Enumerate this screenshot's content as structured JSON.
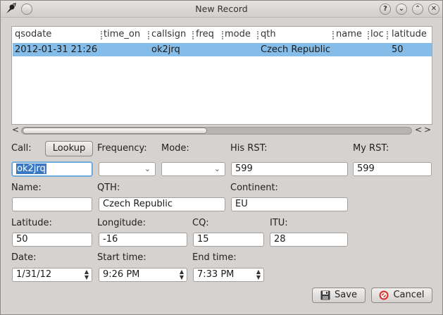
{
  "window": {
    "title": "New Record",
    "titlebar_buttons": {
      "help": "?",
      "minimize": "⌄",
      "maximize": "⌃",
      "close": "✕"
    }
  },
  "table": {
    "columns": [
      "qsodate",
      "time_on",
      "callsign",
      "freq",
      "mode",
      "qth",
      "name",
      "loc",
      "latitude"
    ],
    "rows": [
      {
        "qsodate": "2012-01-31 21:26",
        "time_on": "",
        "callsign": "ok2jrq",
        "freq": "",
        "mode": "",
        "qth": "Czech Republic",
        "name": "",
        "loc": "",
        "latitude": "50"
      }
    ]
  },
  "scrollbar": {
    "left_arrow": "<",
    "right_arrow_left": "<",
    "right_arrow_right": ">"
  },
  "form": {
    "call_label": "Call:",
    "lookup_label": "Lookup",
    "frequency_label": "Frequency:",
    "mode_label": "Mode:",
    "his_rst_label": "His RST:",
    "my_rst_label": "My RST:",
    "call_value": "ok2jrq",
    "frequency_value": "",
    "mode_value": "",
    "his_rst_value": "599",
    "my_rst_value": "599",
    "name_label": "Name:",
    "qth_label": "QTH:",
    "continent_label": "Continent:",
    "name_value": "",
    "qth_value": "Czech Republic",
    "continent_value": "EU",
    "latitude_label": "Latitude:",
    "longitude_label": "Longitude:",
    "cq_label": "CQ:",
    "itu_label": "ITU:",
    "latitude_value": "50",
    "longitude_value": "-16",
    "cq_value": "15",
    "itu_value": "28",
    "date_label": "Date:",
    "start_time_label": "Start time:",
    "end_time_label": "End time:",
    "date_value": "1/31/12",
    "start_time_value": "9:26 PM",
    "end_time_value": "7:33 PM"
  },
  "buttons": {
    "save": "Save",
    "cancel": "Cancel"
  }
}
